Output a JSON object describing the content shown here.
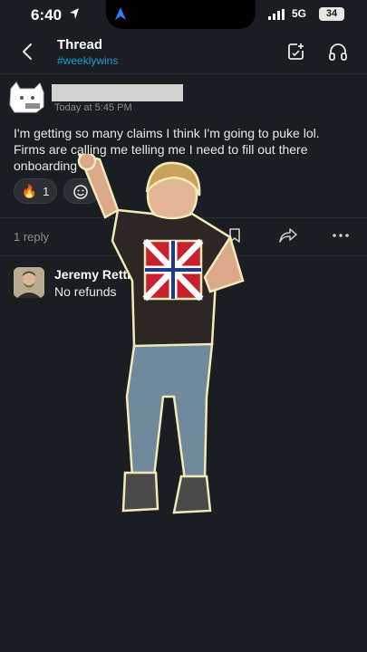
{
  "status_bar": {
    "time": "6:40",
    "network": "5G",
    "battery": "34"
  },
  "header": {
    "title": "Thread",
    "channel": "#weeklywins"
  },
  "message": {
    "timestamp": "Today at 5:45 PM",
    "text": "I'm getting so many claims I think I'm going to puke lol. Firms are calling me telling me I need to fill out there onboarding",
    "reactions": [
      {
        "emoji": "🔥",
        "count": "1"
      }
    ]
  },
  "thread": {
    "reply_count": "1 reply"
  },
  "reply": {
    "author": "Jeremy Rettig",
    "text": "No refunds"
  },
  "icons": {
    "back": "chevron-left-icon",
    "compose": "compose-icon",
    "headphones": "headphones-icon",
    "add_reaction": "smiley-add-icon",
    "bookmark": "bookmark-icon",
    "share": "share-icon",
    "more": "more-horizontal-icon"
  },
  "colors": {
    "background": "#1a1d21",
    "channel_link": "#1d9bd1",
    "muted_text": "#8a8d91"
  }
}
